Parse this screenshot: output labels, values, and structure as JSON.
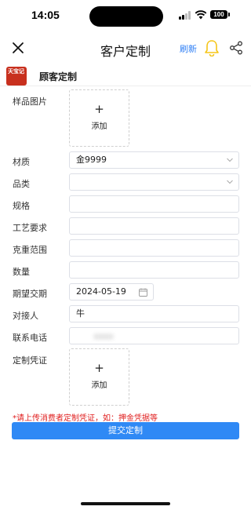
{
  "status_bar": {
    "time": "14:05",
    "battery": "100"
  },
  "navbar": {
    "title": "客户定制",
    "refresh_label": "刷新"
  },
  "shop": {
    "name": "顾客定制",
    "logo_text": "天宝记"
  },
  "form": {
    "sample_image": {
      "label": "样品图片",
      "plus": "+",
      "add_label": "添加"
    },
    "material": {
      "label": "材质",
      "value": "金9999"
    },
    "category": {
      "label": "品类",
      "value": ""
    },
    "spec": {
      "label": "规格",
      "value": ""
    },
    "craft": {
      "label": "工艺要求",
      "value": ""
    },
    "weight_range": {
      "label": "克重范围",
      "value": ""
    },
    "quantity": {
      "label": "数量",
      "value": ""
    },
    "delivery_date": {
      "label": "期望交期",
      "value": "2024-05-19"
    },
    "contact": {
      "label": "对接人",
      "value": "牛"
    },
    "phone": {
      "label": "联系电话",
      "value": ""
    },
    "voucher": {
      "label": "定制凭证",
      "plus": "+",
      "add_label": "添加"
    }
  },
  "hint": "*请上传消费者定制凭证，如：押金凭据等",
  "submit_label": "提交定制",
  "colors": {
    "accent": "#2f89f5",
    "warning": "#e02020",
    "bell": "#f5c518"
  }
}
